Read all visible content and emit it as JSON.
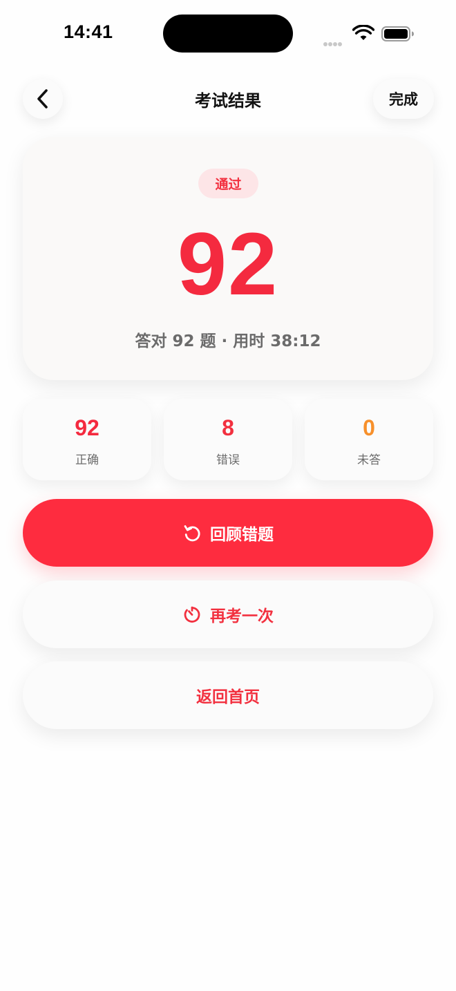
{
  "status_bar": {
    "time": "14:41"
  },
  "nav": {
    "title": "考试结果",
    "done_label": "完成"
  },
  "result": {
    "badge": "通过",
    "score": "92",
    "summary": "答对 92 题 · 用时 38:12"
  },
  "stats": [
    {
      "value": "92",
      "label": "正确",
      "color": "#f42a3f"
    },
    {
      "value": "8",
      "label": "错误",
      "color": "#f2303f"
    },
    {
      "value": "0",
      "label": "未答",
      "color": "#f7902b"
    }
  ],
  "actions": {
    "review_label": "回顾错题",
    "retake_label": "再考一次",
    "home_label": "返回首页"
  },
  "icons": {
    "back": "chevron-left-icon",
    "review": "rotate-ccw-icon",
    "retake": "timer-icon"
  },
  "colors": {
    "accent": "#fe2c3f",
    "unanswered": "#f7902b"
  }
}
